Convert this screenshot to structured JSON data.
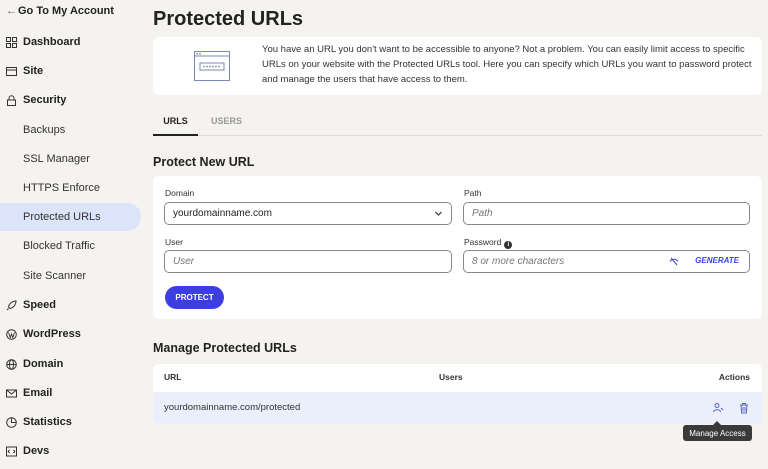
{
  "sidebar": {
    "back_label": "Go To My Account",
    "items": [
      {
        "label": "Dashboard",
        "icon": "dashboard-icon"
      },
      {
        "label": "Site",
        "icon": "site-icon"
      },
      {
        "label": "Security",
        "icon": "lock-icon"
      },
      {
        "label": "Backups"
      },
      {
        "label": "SSL Manager"
      },
      {
        "label": "HTTPS Enforce"
      },
      {
        "label": "Protected URLs",
        "active": true
      },
      {
        "label": "Blocked Traffic"
      },
      {
        "label": "Site Scanner"
      },
      {
        "label": "Speed",
        "icon": "rocket-icon"
      },
      {
        "label": "WordPress",
        "icon": "wordpress-icon"
      },
      {
        "label": "Domain",
        "icon": "globe-icon"
      },
      {
        "label": "Email",
        "icon": "mail-icon"
      },
      {
        "label": "Statistics",
        "icon": "chart-icon"
      },
      {
        "label": "Devs",
        "icon": "code-icon"
      }
    ]
  },
  "page": {
    "title": "Protected URLs",
    "intro": "You have an URL you don't want to be accessible to anyone? Not a problem. You can easily limit access to specific URLs on your website with the Protected URLs tool. Here you can specify which URLs you want to password protect and manage the users that have access to them."
  },
  "tabs": [
    {
      "label": "URLS",
      "active": true
    },
    {
      "label": "USERS",
      "active": false
    }
  ],
  "protect_form": {
    "heading": "Protect New URL",
    "domain_label": "Domain",
    "domain_value": "yourdomainname.com",
    "path_label": "Path",
    "path_placeholder": "Path",
    "user_label": "User",
    "user_placeholder": "User",
    "password_label": "Password",
    "password_placeholder": "8 or more characters",
    "generate_label": "GENERATE",
    "submit_label": "PROTECT"
  },
  "manage": {
    "heading": "Manage Protected URLs",
    "columns": [
      "URL",
      "Users",
      "Actions"
    ],
    "rows": [
      {
        "url": "yourdomainname.com/protected",
        "users": ""
      }
    ],
    "tooltip": "Manage Access"
  },
  "colors": {
    "accent": "#3d3ee0",
    "active_nav": "#dce4f9",
    "row_highlight": "#eaeffb",
    "background": "#f5f3ef"
  }
}
